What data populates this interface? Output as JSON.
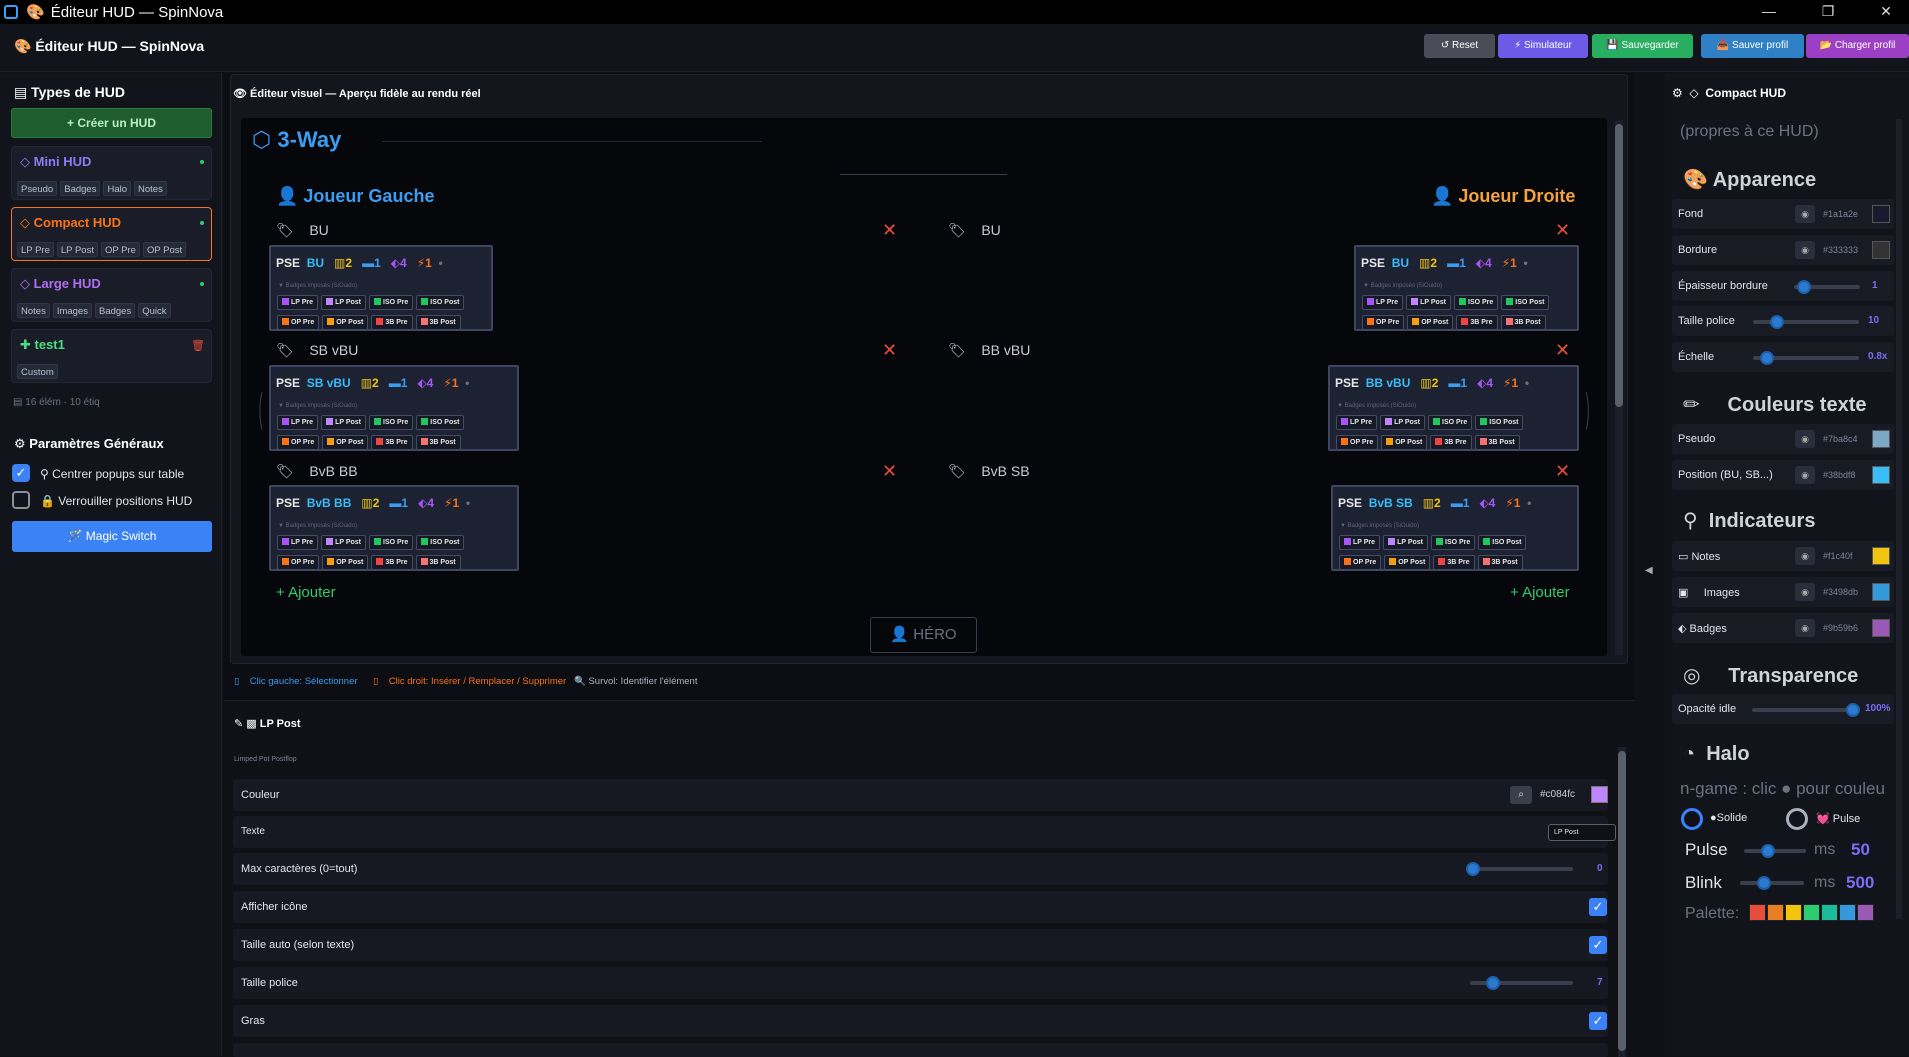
{
  "window": {
    "title": "Éditeur HUD — SpinNova",
    "minimize": "—",
    "maximize": "❐",
    "close": "✕"
  },
  "header": {
    "title": "Éditeur HUD — SpinNova",
    "buttons": {
      "reset": "Reset",
      "simulateur": "Simulateur",
      "sauvegarder": "Sauvegarder",
      "sauver_profil": "Sauver profil",
      "charger_profil": "Charger profil"
    }
  },
  "sidebar": {
    "title": "Types de HUD",
    "create_button": "+ Créer un HUD",
    "huds": [
      {
        "name": "Mini HUD",
        "color": "#8b5cf6",
        "chips": [
          "Pseudo",
          "Badges",
          "Halo",
          "Notes"
        ]
      },
      {
        "name": "Compact HUD",
        "color": "#f97316",
        "chips": [
          "LP Pre",
          "LP Post",
          "OP Pre",
          "OP Post"
        ]
      },
      {
        "name": "Large HUD",
        "color": "#a855f7",
        "chips": [
          "Notes",
          "Images",
          "Badges",
          "Quick"
        ]
      },
      {
        "name": "test1",
        "color": "#22c55e",
        "chips": [
          "Custom"
        ]
      }
    ],
    "stats": "16 élém · 10 étiq",
    "settings_title": "Paramètres Généraux",
    "opt_center": "Centrer popups sur table",
    "opt_lock": "Verrouiller positions HUD",
    "magic_switch": "Magic Switch"
  },
  "editor": {
    "title": "Éditeur visuel — Aperçu fidèle au rendu réel",
    "table_name": "3-Way",
    "left_player": "Joueur Gauche",
    "right_player": "Joueur Droite",
    "rows_left": [
      "BU",
      "SB vBU",
      "BvB BB"
    ],
    "rows_right": [
      "BU",
      "BB vBU",
      "BvB SB"
    ],
    "hud_positions_left": [
      "BU",
      "SB vBU",
      "BvB BB"
    ],
    "hud_positions_right": [
      "BU",
      "BB vBU",
      "BvB SB"
    ],
    "hud_pse": "PSE",
    "hud_stats": [
      "2",
      "1",
      "4",
      "1"
    ],
    "hud_sub": "▼ Badges imposés (SiOuido)",
    "badges_row1": [
      "LP Pre",
      "LP Post",
      "ISO Pre",
      "ISO Post"
    ],
    "badges_row2": [
      "OP Pre",
      "OP Post",
      "3B Pre",
      "3B Post"
    ],
    "add_label": "+ Ajouter",
    "hero": "HÉRO"
  },
  "hints": {
    "left": "Clic gauche: Sélectionner",
    "right": "Clic droit: Insérer / Remplacer / Supprimer",
    "hover": "Survol: Identifier l'élément"
  },
  "properties": {
    "title": "LP Post",
    "subtitle": "Limped Pot Postflop",
    "couleur_label": "Couleur",
    "couleur_value": "#c084fc",
    "texte_label": "Texte",
    "texte_value": "LP Post",
    "maxchars_label": "Max caractères (0=tout)",
    "maxchars_value": "0",
    "icone_label": "Afficher icône",
    "autosize_label": "Taille auto (selon texte)",
    "taille_label": "Taille police",
    "taille_value": "7",
    "gras_label": "Gras"
  },
  "right": {
    "title": "Compact HUD",
    "subtitle": "(propres à ce HUD)",
    "apparence": "Apparence",
    "fond": "Fond",
    "fond_hex": "#1a1a2e",
    "bordure": "Bordure",
    "bordure_hex": "#333333",
    "epaisseur": "Épaisseur bordure",
    "epaisseur_v": "1",
    "taille": "Taille police",
    "taille_v": "10",
    "echelle": "Échelle",
    "echelle_v": "0.8x",
    "couleurs_texte": "Couleurs texte",
    "pseudo": "Pseudo",
    "pseudo_hex": "#7ba8c4",
    "position": "Position (BU, SB...)",
    "position_hex": "#38bdf8",
    "indicateurs": "Indicateurs",
    "notes": "Notes",
    "notes_hex": "#f1c40f",
    "images": "Images",
    "images_hex": "#3498db",
    "badges": "Badges",
    "badges_hex": "#9b59b6",
    "transparence": "Transparence",
    "opacite": "Opacité idle",
    "opacite_v": "100%",
    "halo": "Halo",
    "halo_hint": "n-game : clic ● pour couleu",
    "solide": "●Solide",
    "pulse_opt": "💓 Pulse",
    "pulse": "Pulse",
    "pulse_v": "50",
    "blink": "Blink",
    "blink_v": "500",
    "ms": "ms",
    "palette": "Palette:",
    "palette_colors": [
      "#e74c3c",
      "#e67e22",
      "#f1c40f",
      "#2ecc71",
      "#1abc9c",
      "#3498db",
      "#9b59b6"
    ]
  }
}
